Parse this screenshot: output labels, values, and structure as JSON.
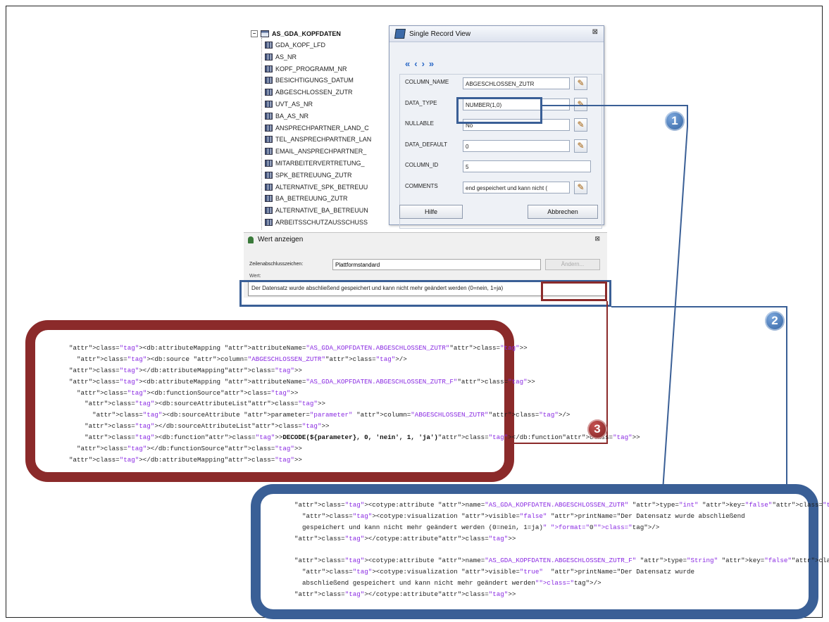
{
  "tree": {
    "root": "AS_GDA_KOPFDATEN",
    "columns": [
      "GDA_KOPF_LFD",
      "AS_NR",
      "KOPF_PROGRAMM_NR",
      "BESICHTIGUNGS_DATUM",
      "ABGESCHLOSSEN_ZUTR",
      "UVT_AS_NR",
      "BA_AS_NR",
      "ANSPRECHPARTNER_LAND_C",
      "TEL_ANSPRECHPARTNER_LAN",
      "EMAIL_ANSPRECHPARTNER_",
      "MITARBEITERVERTRETUNG_",
      "SPK_BETREUUNG_ZUTR",
      "ALTERNATIVE_SPK_BETREUU",
      "BA_BETREUUNG_ZUTR",
      "ALTERNATIVE_BA_BETREUUN",
      "ARBEITSSCHUTZAUSSCHUSS"
    ]
  },
  "single_record_view": {
    "title": "Single Record View",
    "nav": [
      "«",
      "‹",
      "›",
      "»"
    ],
    "properties": [
      {
        "label": "COLUMN_NAME",
        "value": "ABGESCHLOSSEN_ZUTR",
        "editable": true
      },
      {
        "label": "DATA_TYPE",
        "value": "NUMBER(1,0)",
        "editable": true
      },
      {
        "label": "NULLABLE",
        "value": "No",
        "editable": true
      },
      {
        "label": "DATA_DEFAULT",
        "value": "0",
        "editable": true
      },
      {
        "label": "COLUMN_ID",
        "value": "5",
        "editable": false
      },
      {
        "label": "COMMENTS",
        "value": "end gespeichert und kann nicht (",
        "editable": true
      }
    ],
    "help_button": "Hilfe",
    "cancel_button": "Abbrechen"
  },
  "wert_anzeigen": {
    "title": "Wert anzeigen",
    "line_end_label": "Zeilenabschlusszeichen:",
    "line_end_value": "Plattformstandard",
    "change_button": "Ändern...",
    "value_label": "Wert:",
    "value": "Der Datensatz wurde abschließend gespeichert und kann nicht mehr geändert werden (0=nein, 1=ja)"
  },
  "badges": [
    "1",
    "2",
    "3"
  ],
  "code_mapping": [
    "<db:attributeMapping attributeName=\"AS_GDA_KOPFDATEN.ABGESCHLOSSEN_ZUTR\">",
    "  <db:source column=\"ABGESCHLOSSEN_ZUTR\"/>",
    "</db:attributeMapping>",
    "<db:attributeMapping attributeName=\"AS_GDA_KOPFDATEN.ABGESCHLOSSEN_ZUTR_F\">",
    "  <db:functionSource>",
    "    <db:sourceAttributeList>",
    "      <db:sourceAttribute parameter=\"parameter\" column=\"ABGESCHLOSSEN_ZUTR\"/>",
    "    </db:sourceAttributeList>",
    "    <db:function>DECODE(${parameter}, 0, 'nein', 1, 'ja')</db:function>",
    "  </db:functionSource>",
    "</db:attributeMapping>"
  ],
  "code_cotype": [
    "<cotype:attribute name=\"AS_GDA_KOPFDATEN.ABGESCHLOSSEN_ZUTR\" type=\"int\" key=\"false\">",
    "  <cotype:visualization visible=\"false\" printName=\"Der Datensatz wurde abschließend",
    "  gespeichert und kann nicht mehr geändert werden (0=nein, 1=ja)\" format=\"0\"/>",
    "</cotype:attribute>",
    "",
    "<cotype:attribute name=\"AS_GDA_KOPFDATEN.ABGESCHLOSSEN_ZUTR_F\" type=\"String\" key=\"false\">",
    "  <cotype:visualization visible=\"true\"  printName=\"Der Datensatz wurde",
    "  abschließend gespeichert und kann nicht mehr geändert werden\"/>",
    "</cotype:attribute>"
  ],
  "colors": {
    "highlight_blue": "#3a5f96",
    "highlight_red": "#8b2a2a",
    "xml_tag": "#8a2be2",
    "xml_attribute": "#d81e1e"
  }
}
